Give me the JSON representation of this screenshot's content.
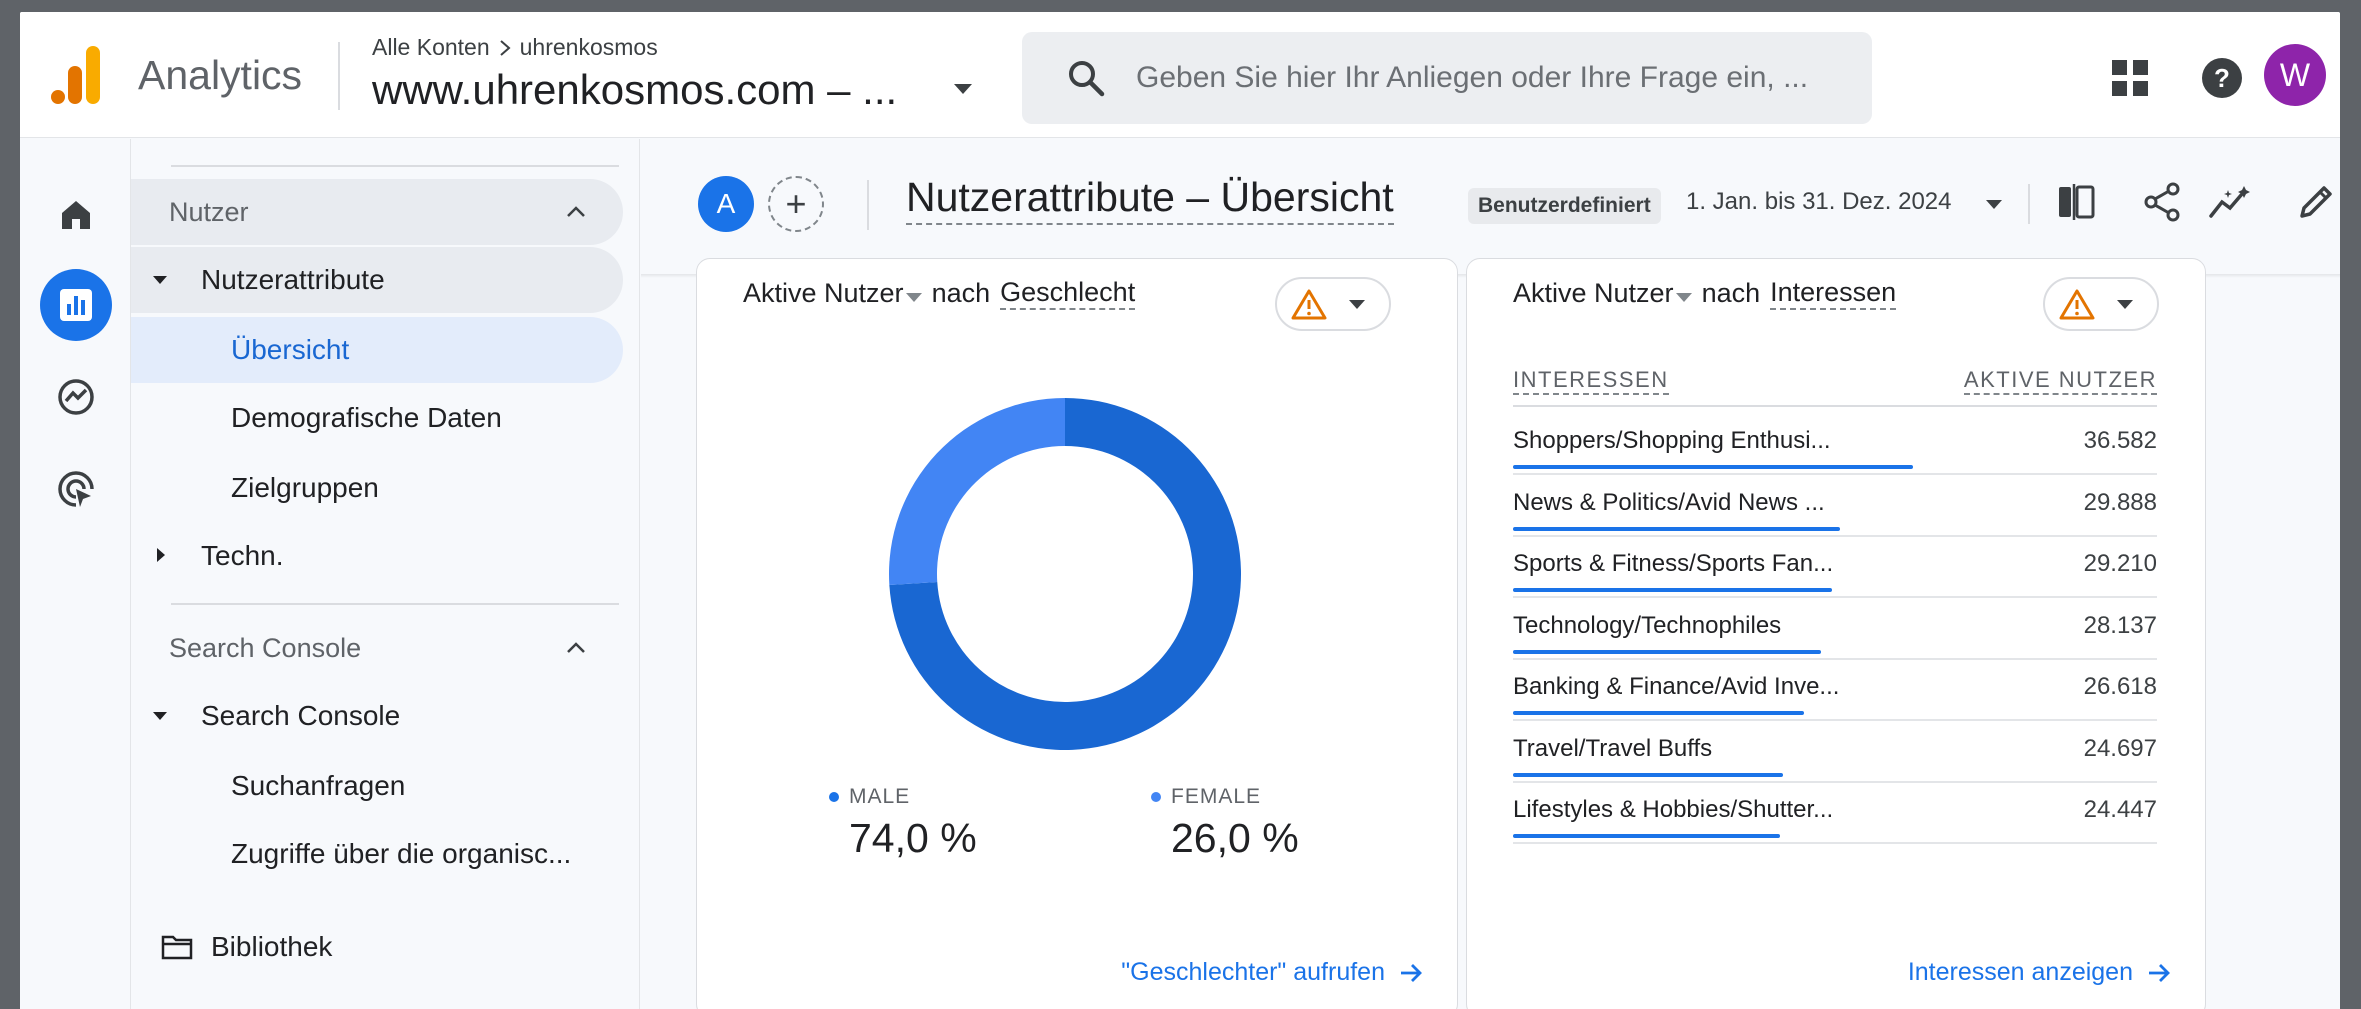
{
  "header": {
    "app_name": "Analytics",
    "breadcrumb_root": "Alle Konten",
    "breadcrumb_child": "uhrenkosmos",
    "property": "www.uhrenkosmos.com – ...",
    "search_placeholder": "Geben Sie hier Ihr Anliegen oder Ihre Frage ein, ...",
    "avatar_initial": "W"
  },
  "rail": [
    "home-icon",
    "reports-icon",
    "explore-icon",
    "advertising-icon"
  ],
  "sidebar": {
    "section_users": "Nutzer",
    "user_attributes": "Nutzerattribute",
    "overview": "Übersicht",
    "demographics": "Demografische Daten",
    "audiences": "Zielgruppen",
    "tech": "Techn.",
    "section_search_console": "Search Console",
    "search_console_group": "Search Console",
    "queries": "Suchanfragen",
    "organic_traffic": "Zugriffe über die organisc...",
    "library": "Bibliothek"
  },
  "page": {
    "comparison_badge": "A",
    "title": "Nutzerattribute – Übersicht",
    "date_chip": "Benutzerdefiniert",
    "date_range": "1. Jan. bis 31. Dez. 2024"
  },
  "gender_card": {
    "metric": "Aktive Nutzer",
    "connector": "nach",
    "dimension": "Geschlecht",
    "link": "\"Geschlechter\" aufrufen"
  },
  "interests_card": {
    "metric": "Aktive Nutzer",
    "connector": "nach",
    "dimension": "Interessen",
    "col_interest": "INTERESSEN",
    "col_users": "AKTIVE NUTZER",
    "link": "Interessen anzeigen",
    "rows": [
      {
        "label": "Shoppers/Shopping Enthusi...",
        "value": "36.582"
      },
      {
        "label": "News & Politics/Avid News ...",
        "value": "29.888"
      },
      {
        "label": "Sports & Fitness/Sports Fan...",
        "value": "29.210"
      },
      {
        "label": "Technology/Technophiles",
        "value": "28.137"
      },
      {
        "label": "Banking & Finance/Avid Inve...",
        "value": "26.618"
      },
      {
        "label": "Travel/Travel Buffs",
        "value": "24.697"
      },
      {
        "label": "Lifestyles & Hobbies/Shutter...",
        "value": "24.447"
      }
    ]
  },
  "chart_data": [
    {
      "type": "pie",
      "categories": [
        "MALE",
        "FEMALE"
      ],
      "values": [
        74.0,
        26.0
      ],
      "value_labels": [
        "74,0 %",
        "26,0 %"
      ],
      "colors": [
        "#1967d2",
        "#4285f4"
      ]
    },
    {
      "type": "bar",
      "categories": [
        "Shoppers/Shopping Enthusi...",
        "News & Politics/Avid News ...",
        "Sports & Fitness/Sports Fan...",
        "Technology/Technophiles",
        "Banking & Finance/Avid Inve...",
        "Travel/Travel Buffs",
        "Lifestyles & Hobbies/Shutter..."
      ],
      "values": [
        36582,
        29888,
        29210,
        28137,
        26618,
        24697,
        24447
      ],
      "colors": [
        "#1a73e8"
      ]
    }
  ],
  "colors": {
    "accent": "#1a73e8",
    "warning": "#e37400",
    "avatar": "#8e24aa"
  }
}
